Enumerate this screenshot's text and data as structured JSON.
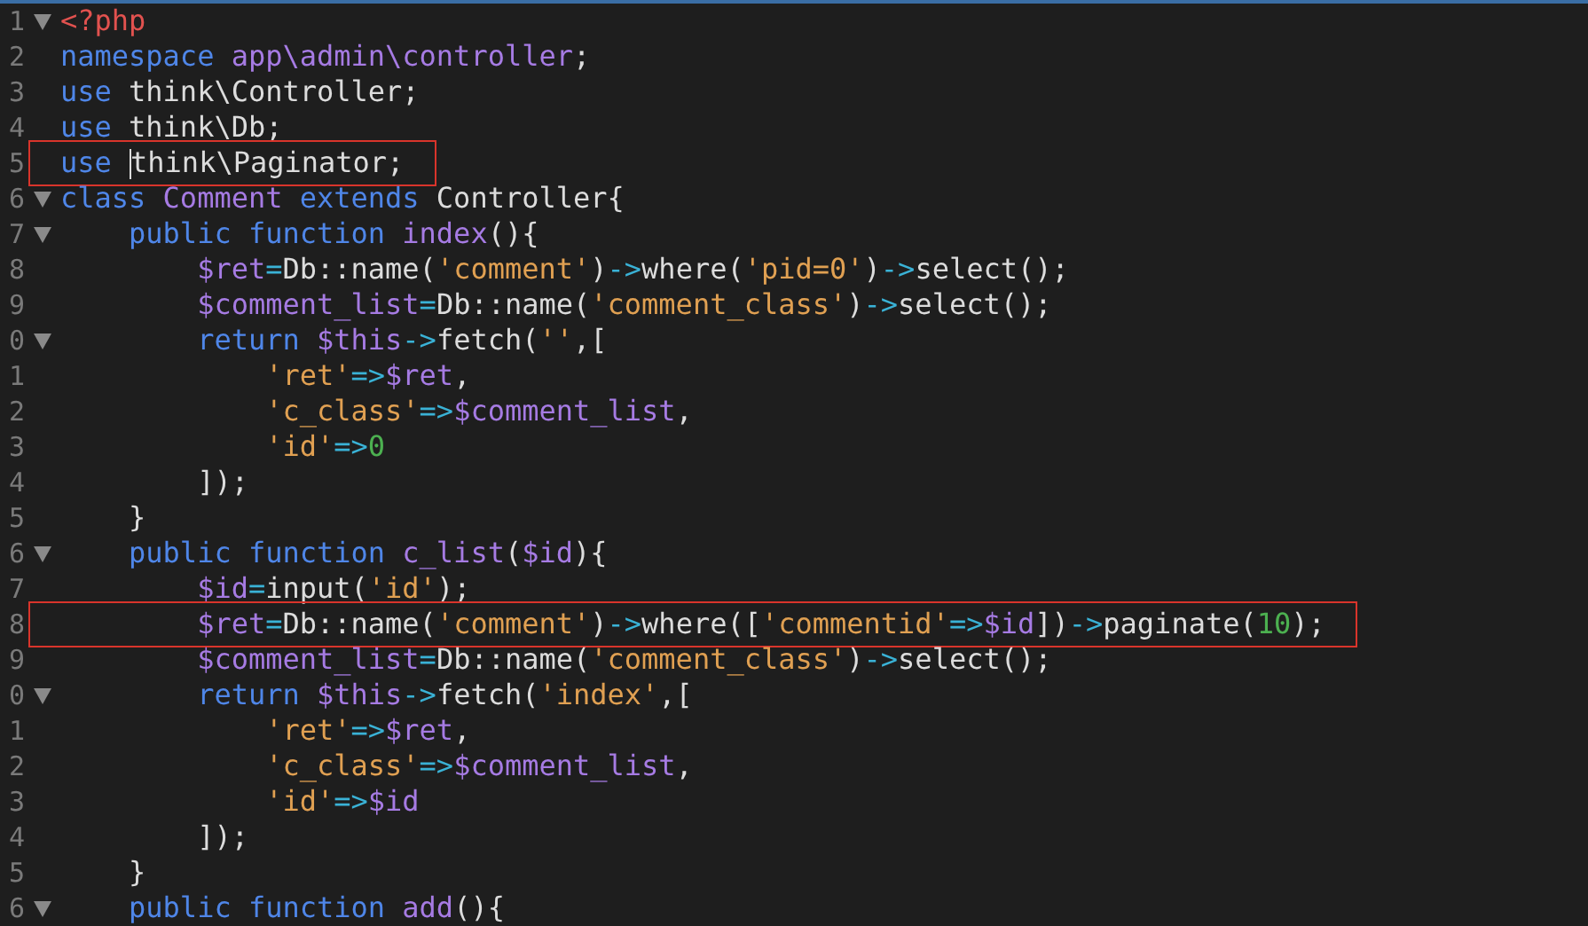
{
  "editor": {
    "lines": [
      {
        "num": "1",
        "fold": true,
        "boxed": false,
        "tokens": [
          {
            "kind": "tag",
            "text": "<?php"
          }
        ]
      },
      {
        "num": "2",
        "fold": false,
        "boxed": false,
        "tokens": [
          {
            "kind": "kw",
            "text": "namespace "
          },
          {
            "kind": "ns",
            "text": "app\\admin\\controller"
          },
          {
            "kind": "plain",
            "text": ";"
          }
        ]
      },
      {
        "num": "3",
        "fold": false,
        "boxed": false,
        "tokens": [
          {
            "kind": "kw",
            "text": "use "
          },
          {
            "kind": "plain",
            "text": "think\\Controller;"
          }
        ]
      },
      {
        "num": "4",
        "fold": false,
        "boxed": false,
        "tokens": [
          {
            "kind": "kw",
            "text": "use "
          },
          {
            "kind": "plain",
            "text": "think\\Db;"
          }
        ]
      },
      {
        "num": "5",
        "fold": false,
        "boxed": true,
        "tokens": [
          {
            "kind": "kw",
            "text": "use "
          },
          {
            "kind": "plain",
            "text": "think\\Paginator;",
            "caret": true
          }
        ]
      },
      {
        "num": "6",
        "fold": true,
        "boxed": false,
        "tokens": [
          {
            "kind": "kw",
            "text": "class "
          },
          {
            "kind": "ns",
            "text": "Comment "
          },
          {
            "kind": "kw",
            "text": "extends "
          },
          {
            "kind": "plain",
            "text": "Controller{"
          }
        ]
      },
      {
        "num": "7",
        "fold": true,
        "boxed": false,
        "tokens": [
          {
            "kind": "kw",
            "text": "    public function "
          },
          {
            "kind": "ns",
            "text": "index"
          },
          {
            "kind": "plain",
            "text": "(){"
          }
        ]
      },
      {
        "num": "8",
        "fold": false,
        "boxed": false,
        "tokens": [
          {
            "kind": "var",
            "text": "        $ret"
          },
          {
            "kind": "op",
            "text": "="
          },
          {
            "kind": "plain",
            "text": "Db::name("
          },
          {
            "kind": "str",
            "text": "'comment'"
          },
          {
            "kind": "plain",
            "text": ")"
          },
          {
            "kind": "op",
            "text": "->"
          },
          {
            "kind": "plain",
            "text": "where("
          },
          {
            "kind": "str",
            "text": "'pid=0'"
          },
          {
            "kind": "plain",
            "text": ")"
          },
          {
            "kind": "op",
            "text": "->"
          },
          {
            "kind": "plain",
            "text": "select();"
          }
        ]
      },
      {
        "num": "9",
        "fold": false,
        "boxed": false,
        "tokens": [
          {
            "kind": "var",
            "text": "        $comment_list"
          },
          {
            "kind": "op",
            "text": "="
          },
          {
            "kind": "plain",
            "text": "Db::name("
          },
          {
            "kind": "str",
            "text": "'comment_class'"
          },
          {
            "kind": "plain",
            "text": ")"
          },
          {
            "kind": "op",
            "text": "->"
          },
          {
            "kind": "plain",
            "text": "select();"
          }
        ]
      },
      {
        "num": "0",
        "fold": true,
        "boxed": false,
        "tokens": [
          {
            "kind": "kw",
            "text": "        return "
          },
          {
            "kind": "var",
            "text": "$this"
          },
          {
            "kind": "op",
            "text": "->"
          },
          {
            "kind": "plain",
            "text": "fetch("
          },
          {
            "kind": "str",
            "text": "''"
          },
          {
            "kind": "plain",
            "text": ",["
          }
        ]
      },
      {
        "num": "1",
        "fold": false,
        "boxed": false,
        "tokens": [
          {
            "kind": "str",
            "text": "            'ret'"
          },
          {
            "kind": "op",
            "text": "=>"
          },
          {
            "kind": "var",
            "text": "$ret"
          },
          {
            "kind": "plain",
            "text": ","
          }
        ]
      },
      {
        "num": "2",
        "fold": false,
        "boxed": false,
        "tokens": [
          {
            "kind": "str",
            "text": "            'c_class'"
          },
          {
            "kind": "op",
            "text": "=>"
          },
          {
            "kind": "var",
            "text": "$comment_list"
          },
          {
            "kind": "plain",
            "text": ","
          }
        ]
      },
      {
        "num": "3",
        "fold": false,
        "boxed": false,
        "tokens": [
          {
            "kind": "str",
            "text": "            'id'"
          },
          {
            "kind": "op",
            "text": "=>"
          },
          {
            "kind": "num",
            "text": "0"
          }
        ]
      },
      {
        "num": "4",
        "fold": false,
        "boxed": false,
        "tokens": [
          {
            "kind": "plain",
            "text": "        ]);"
          }
        ]
      },
      {
        "num": "5",
        "fold": false,
        "boxed": false,
        "tokens": [
          {
            "kind": "plain",
            "text": "    }"
          }
        ]
      },
      {
        "num": "6",
        "fold": true,
        "boxed": false,
        "tokens": [
          {
            "kind": "kw",
            "text": "    public function "
          },
          {
            "kind": "ns",
            "text": "c_list"
          },
          {
            "kind": "plain",
            "text": "("
          },
          {
            "kind": "var",
            "text": "$id"
          },
          {
            "kind": "plain",
            "text": "){"
          }
        ]
      },
      {
        "num": "7",
        "fold": false,
        "boxed": false,
        "tokens": [
          {
            "kind": "var",
            "text": "        $id"
          },
          {
            "kind": "op",
            "text": "="
          },
          {
            "kind": "plain",
            "text": "input("
          },
          {
            "kind": "str",
            "text": "'id'"
          },
          {
            "kind": "plain",
            "text": ");"
          }
        ]
      },
      {
        "num": "8",
        "fold": false,
        "boxed": true,
        "tokens": [
          {
            "kind": "var",
            "text": "        $ret"
          },
          {
            "kind": "op",
            "text": "="
          },
          {
            "kind": "plain",
            "text": "Db::name("
          },
          {
            "kind": "str",
            "text": "'comment'"
          },
          {
            "kind": "plain",
            "text": ")"
          },
          {
            "kind": "op",
            "text": "->"
          },
          {
            "kind": "plain",
            "text": "where(["
          },
          {
            "kind": "str",
            "text": "'commentid'"
          },
          {
            "kind": "op",
            "text": "=>"
          },
          {
            "kind": "var",
            "text": "$id"
          },
          {
            "kind": "plain",
            "text": "])"
          },
          {
            "kind": "op",
            "text": "->"
          },
          {
            "kind": "plain",
            "text": "paginate("
          },
          {
            "kind": "num",
            "text": "10"
          },
          {
            "kind": "plain",
            "text": ");"
          }
        ]
      },
      {
        "num": "9",
        "fold": false,
        "boxed": false,
        "tokens": [
          {
            "kind": "var",
            "text": "        $comment_list"
          },
          {
            "kind": "op",
            "text": "="
          },
          {
            "kind": "plain",
            "text": "Db::name("
          },
          {
            "kind": "str",
            "text": "'comment_class'"
          },
          {
            "kind": "plain",
            "text": ")"
          },
          {
            "kind": "op",
            "text": "->"
          },
          {
            "kind": "plain",
            "text": "select();"
          }
        ]
      },
      {
        "num": "0",
        "fold": true,
        "boxed": false,
        "tokens": [
          {
            "kind": "kw",
            "text": "        return "
          },
          {
            "kind": "var",
            "text": "$this"
          },
          {
            "kind": "op",
            "text": "->"
          },
          {
            "kind": "plain",
            "text": "fetch("
          },
          {
            "kind": "str",
            "text": "'index'"
          },
          {
            "kind": "plain",
            "text": ",["
          }
        ]
      },
      {
        "num": "1",
        "fold": false,
        "boxed": false,
        "tokens": [
          {
            "kind": "str",
            "text": "            'ret'"
          },
          {
            "kind": "op",
            "text": "=>"
          },
          {
            "kind": "var",
            "text": "$ret"
          },
          {
            "kind": "plain",
            "text": ","
          }
        ]
      },
      {
        "num": "2",
        "fold": false,
        "boxed": false,
        "tokens": [
          {
            "kind": "str",
            "text": "            'c_class'"
          },
          {
            "kind": "op",
            "text": "=>"
          },
          {
            "kind": "var",
            "text": "$comment_list"
          },
          {
            "kind": "plain",
            "text": ","
          }
        ]
      },
      {
        "num": "3",
        "fold": false,
        "boxed": false,
        "tokens": [
          {
            "kind": "str",
            "text": "            'id'"
          },
          {
            "kind": "op",
            "text": "=>"
          },
          {
            "kind": "var",
            "text": "$id"
          }
        ]
      },
      {
        "num": "4",
        "fold": false,
        "boxed": false,
        "tokens": [
          {
            "kind": "plain",
            "text": "        ]);"
          }
        ]
      },
      {
        "num": "5",
        "fold": false,
        "boxed": false,
        "tokens": [
          {
            "kind": "plain",
            "text": "    }"
          }
        ]
      },
      {
        "num": "6",
        "fold": true,
        "boxed": false,
        "tokens": [
          {
            "kind": "kw",
            "text": "    public function "
          },
          {
            "kind": "ns",
            "text": "add"
          },
          {
            "kind": "plain",
            "text": "(){"
          }
        ]
      }
    ]
  }
}
